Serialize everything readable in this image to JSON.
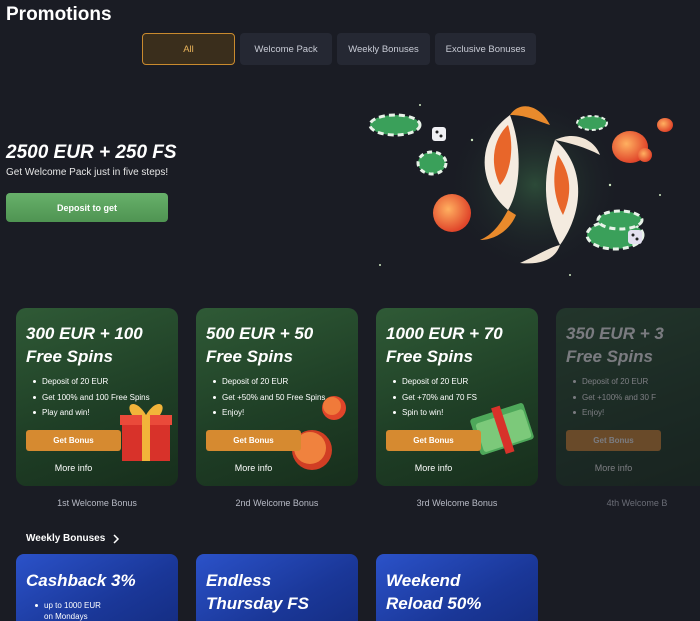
{
  "page": {
    "title": "Promotions"
  },
  "tabs": [
    {
      "label": "All",
      "active": true
    },
    {
      "label": "Welcome Pack",
      "active": false
    },
    {
      "label": "Weekly Bonuses",
      "active": false
    },
    {
      "label": "Exclusive Bonuses",
      "active": false
    }
  ],
  "hero": {
    "title": "2500 EUR + 250 FS",
    "subtitle": "Get Welcome Pack just in five steps!",
    "button_label": "Deposit to get"
  },
  "welcome_cards": [
    {
      "title": "300 EUR + 100\nFree Spins",
      "bullets": [
        "Deposit of 20 EUR",
        "Get 100% and 100 Free Spins",
        "Play and win!"
      ],
      "button": "Get Bonus",
      "more": "More info",
      "caption": "1st Welcome Bonus"
    },
    {
      "title": "500 EUR + 50\nFree Spins",
      "bullets": [
        "Deposit of 20 EUR",
        "Get +50% and 50 Free Spins",
        "Enjoy!"
      ],
      "button": "Get Bonus",
      "more": "More info",
      "caption": "2nd Welcome Bonus"
    },
    {
      "title": "1000 EUR + 70\nFree Spins",
      "bullets": [
        "Deposit of 20 EUR",
        "Get +70% and 70 FS",
        "Spin to win!"
      ],
      "button": "Get Bonus",
      "more": "More info",
      "caption": "3rd Welcome Bonus"
    },
    {
      "title": "350 EUR + 3\nFree Spins",
      "bullets": [
        "Deposit of 20 EUR",
        "Get +100% and 30 F",
        "Enjoy!"
      ],
      "button": "Get Bonus",
      "more": "More info",
      "caption": "4th Welcome B"
    }
  ],
  "weekly": {
    "section_title": "Weekly Bonuses",
    "cards": [
      {
        "title": "Cashback 3%",
        "lines": [
          "up to 1000 EUR",
          "on Mondays"
        ]
      },
      {
        "title": "Endless\nThursday FS",
        "lines": []
      },
      {
        "title": "Weekend\nReload 50%",
        "lines": []
      }
    ]
  },
  "colors": {
    "background": "#1a1c24",
    "accent_orange": "#d68a30",
    "green_button": "#5fa362",
    "card_green": "#2f5a36",
    "card_blue": "#2b52c9"
  },
  "icons": [
    "chevron-right-icon",
    "koi-fish-illustration",
    "gift-box-icon",
    "casino-chip-icon",
    "cash-stack-icon"
  ]
}
